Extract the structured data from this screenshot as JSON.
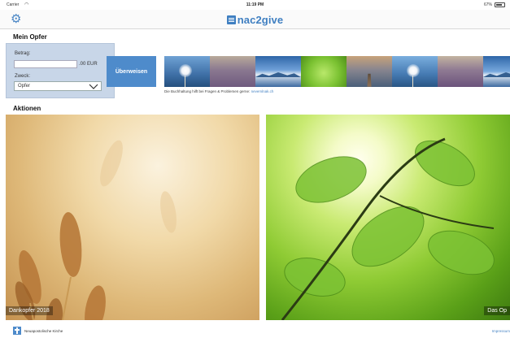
{
  "status_bar": {
    "carrier": "Carrier",
    "time": "11:19 PM",
    "battery": "67%"
  },
  "nav": {
    "brand": "nac2give",
    "settings_icon": "gear-icon"
  },
  "offer": {
    "title": "Mein Opfer",
    "amount_label": "Betrag:",
    "amount_value": "",
    "currency_suffix": ".00 EUR",
    "purpose_label": "Zweck:",
    "purpose_value": "Opfer",
    "transfer_button": "Überweisen"
  },
  "strip": {
    "images": [
      "dandelion",
      "lavender-field",
      "mountain-lake",
      "green-leaf",
      "pier-sunset",
      "dandelion",
      "lavender-field",
      "mountain-lake"
    ],
    "help_text": "Die Buchhaltung hilft bei Fragen & Problemen gerne:",
    "help_link": "nevemlnak.ch"
  },
  "actions": {
    "title": "Aktionen",
    "tiles": [
      {
        "caption": "Dankopfer 2018",
        "image": "wheat-field"
      },
      {
        "caption": "Das Op",
        "image": "green-leaves-sunlight"
      }
    ]
  },
  "footer": {
    "church": "Neuapostolische Kirche",
    "impressum": "Impressum"
  },
  "colors": {
    "accent": "#4e8bcb",
    "brand": "#3f7fc1",
    "offer_panel": "#c8d6e8"
  }
}
